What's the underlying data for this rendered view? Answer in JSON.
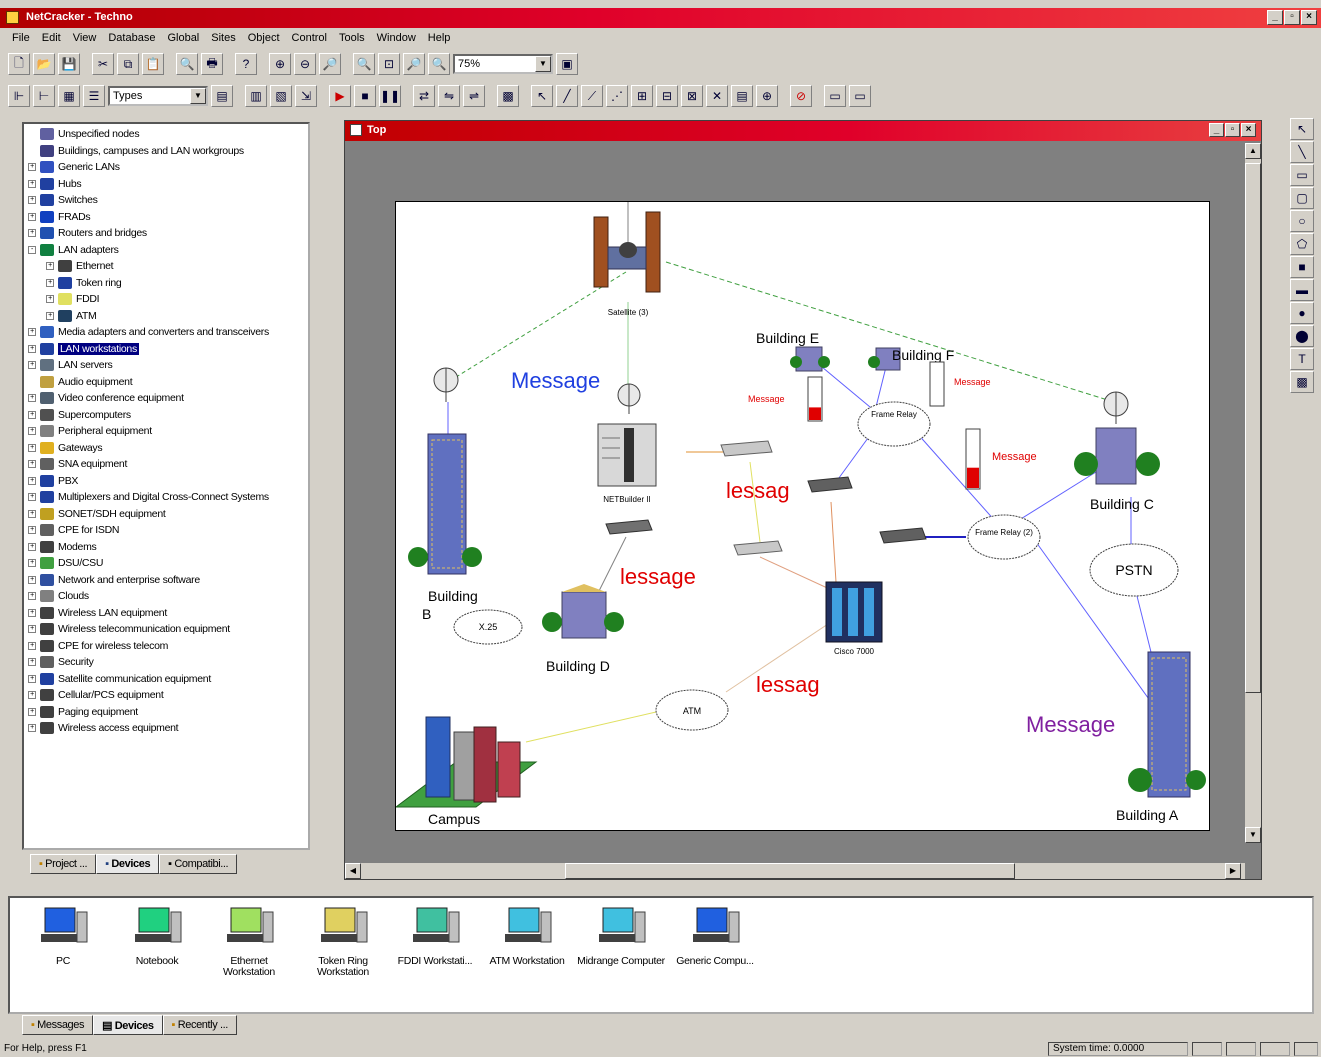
{
  "window": {
    "title": "NetCracker - Techno"
  },
  "menu": [
    "File",
    "Edit",
    "View",
    "Database",
    "Global",
    "Sites",
    "Object",
    "Control",
    "Tools",
    "Window",
    "Help"
  ],
  "toolbar": {
    "zoom_value": "75%",
    "types_value": "Types"
  },
  "tree": {
    "items": [
      {
        "label": "Unspecified nodes",
        "exp": "",
        "color": "#6060a0"
      },
      {
        "label": "Buildings, campuses and LAN workgroups",
        "exp": "",
        "color": "#404080"
      },
      {
        "label": "Generic LANs",
        "exp": "+",
        "color": "#3050c0"
      },
      {
        "label": "Hubs",
        "exp": "+",
        "color": "#2040a0"
      },
      {
        "label": "Switches",
        "exp": "+",
        "color": "#2040a0"
      },
      {
        "label": "FRADs",
        "exp": "+",
        "color": "#1040c0"
      },
      {
        "label": "Routers and bridges",
        "exp": "+",
        "color": "#2050b0"
      },
      {
        "label": "LAN adapters",
        "exp": "-",
        "color": "#108040"
      },
      {
        "label": "Ethernet",
        "exp": "+",
        "color": "#404040",
        "indent": 1
      },
      {
        "label": "Token ring",
        "exp": "+",
        "color": "#2040a0",
        "indent": 1
      },
      {
        "label": "FDDI",
        "exp": "+",
        "color": "#e0e060",
        "indent": 1
      },
      {
        "label": "ATM",
        "exp": "+",
        "color": "#204060",
        "indent": 1
      },
      {
        "label": "Media adapters and converters and transceivers",
        "exp": "+",
        "color": "#3060c0"
      },
      {
        "label": "LAN workstations",
        "exp": "+",
        "color": "#2040a0",
        "selected": true
      },
      {
        "label": "LAN servers",
        "exp": "+",
        "color": "#607080"
      },
      {
        "label": "Audio equipment",
        "exp": "",
        "color": "#c0a040"
      },
      {
        "label": "Video conference equipment",
        "exp": "+",
        "color": "#506070"
      },
      {
        "label": "Supercomputers",
        "exp": "+",
        "color": "#505050"
      },
      {
        "label": "Peripheral equipment",
        "exp": "+",
        "color": "#808080"
      },
      {
        "label": "Gateways",
        "exp": "+",
        "color": "#e0b020"
      },
      {
        "label": "SNA equipment",
        "exp": "+",
        "color": "#606060"
      },
      {
        "label": "PBX",
        "exp": "+",
        "color": "#2040a0"
      },
      {
        "label": "Multiplexers and Digital Cross-Connect Systems",
        "exp": "+",
        "color": "#2040a0"
      },
      {
        "label": "SONET/SDH equipment",
        "exp": "+",
        "color": "#c0a020"
      },
      {
        "label": "CPE for ISDN",
        "exp": "+",
        "color": "#606060"
      },
      {
        "label": "Modems",
        "exp": "+",
        "color": "#404040"
      },
      {
        "label": "DSU/CSU",
        "exp": "+",
        "color": "#40a040"
      },
      {
        "label": "Network and enterprise software",
        "exp": "+",
        "color": "#3050a0"
      },
      {
        "label": "Clouds",
        "exp": "+",
        "color": "#808080"
      },
      {
        "label": "Wireless LAN equipment",
        "exp": "+",
        "color": "#404040"
      },
      {
        "label": "Wireless telecommunication equipment",
        "exp": "+",
        "color": "#404040"
      },
      {
        "label": "CPE for wireless telecom",
        "exp": "+",
        "color": "#404040"
      },
      {
        "label": "Security",
        "exp": "+",
        "color": "#606060"
      },
      {
        "label": "Satellite communication equipment",
        "exp": "+",
        "color": "#2040a0"
      },
      {
        "label": "Cellular/PCS equipment",
        "exp": "+",
        "color": "#404040"
      },
      {
        "label": "Paging equipment",
        "exp": "+",
        "color": "#404040"
      },
      {
        "label": "Wireless  access equipment",
        "exp": "+",
        "color": "#404040"
      }
    ]
  },
  "left_tabs": [
    "Project ...",
    "Devices",
    "Compatibi..."
  ],
  "top_window": {
    "title": "Top"
  },
  "diagram": {
    "nodes": {
      "satellite": "Satellite (3)",
      "netbuilder": "NETBuilder II",
      "cisco": "Cisco 7000",
      "building_a": "Building A",
      "building_b": "Building\nB",
      "building_c": "Building C",
      "building_d": "Building D",
      "building_e": "Building E",
      "building_f": "Building F",
      "campus": "Campus"
    },
    "clouds": {
      "x25": "X.25",
      "frame_relay_1": "Frame Relay",
      "frame_relay_2": "Frame Relay (2)",
      "pstn": "PSTN",
      "atm": "ATM"
    },
    "messages": {
      "m1": "Message",
      "m2": "lessag",
      "m3": "lessage",
      "m4": "lessag",
      "m5": "Message",
      "m6": "Message",
      "m7": "Message",
      "m8": "Message"
    },
    "gauges": [
      {
        "level": 0.3
      },
      {
        "level": 0
      },
      {
        "level": 0.35
      }
    ]
  },
  "devices": [
    {
      "label": "PC",
      "type": "pc"
    },
    {
      "label": "Notebook",
      "type": "notebook"
    },
    {
      "label": "Ethernet Workstation",
      "type": "ws"
    },
    {
      "label": "Token Ring Workstation",
      "type": "tr"
    },
    {
      "label": "FDDI Workstati...",
      "type": "fddi"
    },
    {
      "label": "ATM Workstation",
      "type": "atm"
    },
    {
      "label": "Midrange Computer",
      "type": "mid"
    },
    {
      "label": "Generic Compu...",
      "type": "gen"
    }
  ],
  "bottom_tabs": [
    "Messages",
    "Devices",
    "Recently ..."
  ],
  "status": {
    "help": "For Help, press F1",
    "time": "System time: 0.0000"
  }
}
